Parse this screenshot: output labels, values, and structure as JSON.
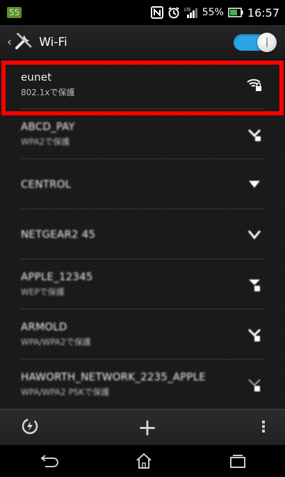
{
  "status_bar": {
    "notification_badge": "55",
    "battery_percent": "55%",
    "time": "16:57",
    "icons": [
      "nfc-icon",
      "alarm-icon",
      "lte-signal-icon",
      "battery-icon"
    ]
  },
  "app_bar": {
    "title": "Wi-Fi",
    "wifi_enabled": true,
    "accent_color": "#2aa4e6"
  },
  "networks": [
    {
      "name": "eunet",
      "status": "802.1xで保護",
      "secured": true,
      "obscured": false
    },
    {
      "name": "ABCD_PAY",
      "status": "WPA2で保護",
      "secured": true,
      "obscured": true
    },
    {
      "name": "CENTROL",
      "status": "",
      "secured": false,
      "obscured": true
    },
    {
      "name": "NETGEAR2 45",
      "status": "",
      "secured": false,
      "obscured": true
    },
    {
      "name": "APPLE_12345",
      "status": "WEPで保護",
      "secured": true,
      "obscured": true
    },
    {
      "name": "ARMOLD",
      "status": "WPA/WPA2で保護",
      "secured": true,
      "obscured": true
    },
    {
      "name": "HAWORTH_NETWORK_2235_APPLE",
      "status": "WPA/WPA2 PSKで保護",
      "secured": true,
      "obscured": true
    }
  ],
  "highlight_color": "#ff0000",
  "action_bar": {
    "add_label": "+",
    "overflow_label": "⋮"
  }
}
